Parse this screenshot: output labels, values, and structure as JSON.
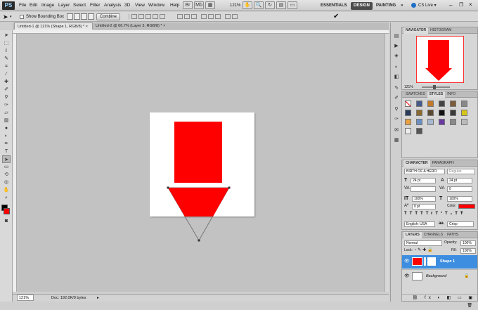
{
  "app": {
    "logo": "PS",
    "menus": [
      "File",
      "Edit",
      "Image",
      "Layer",
      "Select",
      "Filter",
      "Analysis",
      "3D",
      "View",
      "Window",
      "Help"
    ],
    "zoom": "121%",
    "workspaces": [
      "ESSENTIALS",
      "DESIGN",
      "PAINTING"
    ],
    "active_workspace": "DESIGN",
    "more": "»",
    "cs_live": "CS Live ▾"
  },
  "options": {
    "show_bounding_box": "Show Bounding Box",
    "combine": "Combine"
  },
  "tabs": [
    {
      "label": "Untitled-1 @ 121% (Shape 1, RGB/8) *",
      "close": "×"
    },
    {
      "label": "Untitled-2 @ 66.7% (Layer 3, RGB/8) *",
      "close": "×"
    }
  ],
  "status": {
    "zoom": "121%",
    "doc": "Doc: 192.0K/0 bytes"
  },
  "navigator": {
    "tabs": [
      "NAVIGATOR",
      "HISTOGRAM"
    ],
    "zoom": "121%"
  },
  "swatches": {
    "tabs": [
      "SWATCHES",
      "STYLES",
      "INFO"
    ]
  },
  "character": {
    "tabs": [
      "CHARACTER",
      "PARAGRAPH"
    ],
    "font": "BIRTH OF A HERO",
    "style": "Regular",
    "size": "24 pt",
    "leading": "24 pt",
    "tracking": "0",
    "kerning": "",
    "vscale": "100%",
    "hscale": "100%",
    "baseline": "0 pt",
    "color_label": "Color:",
    "language": "English: USA",
    "aa_label": "aa",
    "antialias": "Crisp",
    "style_buttons": [
      "T",
      "T",
      "TT",
      "Tr",
      "T¹",
      "T₁",
      "T",
      "Ŧ"
    ]
  },
  "layers": {
    "tabs": [
      "LAYERS",
      "CHANNELS",
      "PATHS"
    ],
    "blend": "Normal",
    "opacity_label": "Opacity:",
    "opacity": "100%",
    "lock_label": "Lock:",
    "fill_label": "Fill:",
    "fill": "100%",
    "items": [
      {
        "name": "Shape 1"
      },
      {
        "name": "Background"
      }
    ]
  },
  "colors": {
    "accent": "#3d8ee0",
    "shape": "#ff0000"
  }
}
